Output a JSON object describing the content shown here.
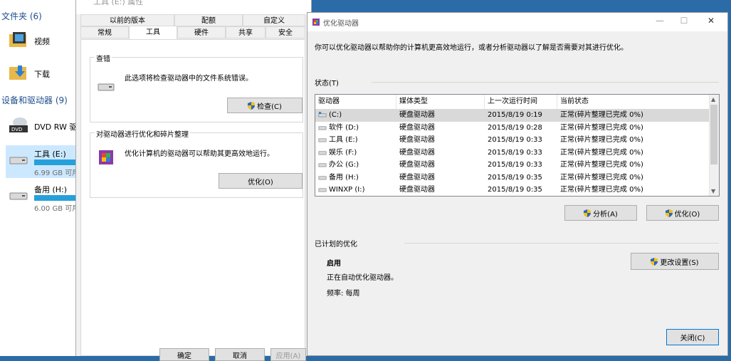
{
  "explorer": {
    "folders_header": "文件夹 (6)",
    "folders": [
      {
        "name": "视频"
      },
      {
        "name": "下载"
      }
    ],
    "devices_header": "设备和驱动器 (9)",
    "drives": [
      {
        "name": "DVD RW 驱",
        "free": ""
      },
      {
        "name": "工具 (E:)",
        "free": "6.99 GB 可用",
        "fill": 0.92
      },
      {
        "name": "备用 (H:)",
        "free": "6.00 GB 可用",
        "fill": 0.93
      }
    ]
  },
  "properties": {
    "title": "工具 (E:) 属性",
    "tabs_row1": [
      "以前的版本",
      "配额",
      "自定义"
    ],
    "tabs_row2": [
      "常规",
      "工具",
      "硬件",
      "共享",
      "安全"
    ],
    "error_check": {
      "label": "查错",
      "desc": "此选项将检查驱动器中的文件系统错误。",
      "button": "检查(C)"
    },
    "optimize": {
      "label": "对驱动器进行优化和碎片整理",
      "desc": "优化计算机的驱动器可以帮助其更高效地运行。",
      "button": "优化(O)"
    },
    "bottom_buttons": [
      "确定",
      "取消",
      "应用(A)"
    ]
  },
  "optimize_window": {
    "title": "优化驱动器",
    "controls": {
      "minimize": "—",
      "maximize": "☐",
      "close": "✕"
    },
    "intro": "你可以优化驱动器以帮助你的计算机更高效地运行，或者分析驱动器以了解是否需要对其进行优化。",
    "status_label": "状态(T)",
    "columns": [
      "驱动器",
      "媒体类型",
      "上一次运行时间",
      "当前状态"
    ],
    "drives": [
      {
        "drive": "(C:)",
        "media": "硬盘驱动器",
        "last_run": "2015/8/19 0:19",
        "status": "正常(碎片整理已完成 0%)"
      },
      {
        "drive": "软件 (D:)",
        "media": "硬盘驱动器",
        "last_run": "2015/8/19 0:28",
        "status": "正常(碎片整理已完成 0%)"
      },
      {
        "drive": "工具 (E:)",
        "media": "硬盘驱动器",
        "last_run": "2015/8/19 0:33",
        "status": "正常(碎片整理已完成 0%)"
      },
      {
        "drive": "娱乐 (F:)",
        "media": "硬盘驱动器",
        "last_run": "2015/8/19 0:33",
        "status": "正常(碎片整理已完成 0%)"
      },
      {
        "drive": "办公 (G:)",
        "media": "硬盘驱动器",
        "last_run": "2015/8/19 0:33",
        "status": "正常(碎片整理已完成 0%)"
      },
      {
        "drive": "备用 (H:)",
        "media": "硬盘驱动器",
        "last_run": "2015/8/19 0:35",
        "status": "正常(碎片整理已完成 0%)"
      },
      {
        "drive": "WINXP (I:)",
        "media": "硬盘驱动器",
        "last_run": "2015/8/19 0:35",
        "status": "正常(碎片整理已完成 0%)"
      }
    ],
    "analyze_button": "分析(A)",
    "optimize_button": "优化(O)",
    "scheduled_label": "已计划的优化",
    "scheduled_state": "启用",
    "scheduled_desc": "正在自动优化驱动器。",
    "frequency": "频率: 每周",
    "change_settings_button": "更改设置(S)",
    "close_button": "关闭(C)"
  },
  "colors": {
    "accent": "#26a0da",
    "desktop": "#2b6ba8",
    "shield_blue": "#2f64c4",
    "shield_yellow": "#f5c400"
  }
}
